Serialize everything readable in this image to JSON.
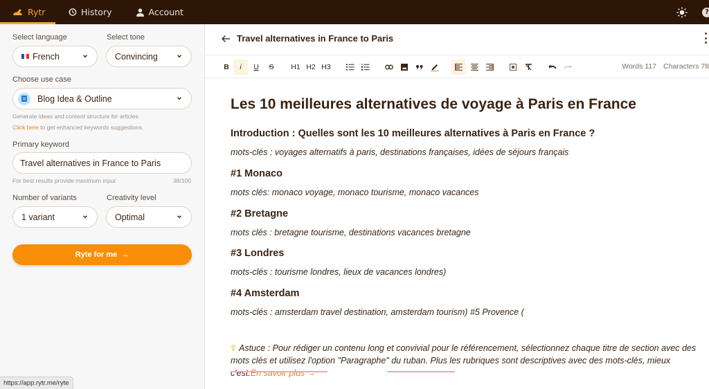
{
  "topnav": {
    "brand": "Rytr",
    "items": [
      {
        "label": "History",
        "icon": "history-icon"
      },
      {
        "label": "Account",
        "icon": "user-icon"
      }
    ],
    "right_icons": [
      "sun-icon",
      "help-icon"
    ],
    "help_glyph": "?"
  },
  "sidebar": {
    "language": {
      "label": "Select language",
      "value": "French"
    },
    "tone": {
      "label": "Select tone",
      "value": "Convincing"
    },
    "use_case": {
      "label": "Choose use case",
      "value": "Blog Idea & Outline",
      "description": "Generate ideas and content structure for articles",
      "link_text": "Click here",
      "link_suffix": " to get enhanced keywords suggestions."
    },
    "keyword": {
      "label": "Primary keyword",
      "value": "Travel alternatives in France to Paris",
      "hint": "For best results provide maximum input",
      "counter": "38/100"
    },
    "variants": {
      "label": "Number of variants",
      "value": "1 variant"
    },
    "creativity": {
      "label": "Creativity level",
      "value": "Optimal"
    },
    "ryte_button": "Ryte for me",
    "ryte_arrow": "→"
  },
  "status_bar": {
    "url": "https://app.rytr.me/ryte"
  },
  "document": {
    "title": "Travel alternatives in France to Paris",
    "toolbar": {
      "bold": "B",
      "italic": "i",
      "underline": "U",
      "strike": "S",
      "h1": "H1",
      "h2": "H2",
      "h3": "H3",
      "active": [
        "italic",
        "align-left"
      ]
    },
    "stats": {
      "words": "Words 117",
      "characters": "Characters 78"
    },
    "content": {
      "h1": "Les 10 meilleures alternatives de voyage à Paris en France",
      "intro_heading": "Introduction : Quelles sont les 10 meilleures alternatives à Paris en France ?",
      "intro_keywords": "mots-clés : voyages alternatifs à paris, destinations françaises, idées de séjours français",
      "sections": [
        {
          "heading": "#1 Monaco",
          "keywords": "mots clés: monaco voyage, monaco tourisme, monaco vacances"
        },
        {
          "heading": "#2 Bretagne",
          "keywords": "mots clés : bretagne tourisme, destinations vacances bretagne"
        },
        {
          "heading": "#3 Londres",
          "keywords": "mots-clés : tourisme londres, lieux de vacances londres)"
        },
        {
          "heading": "#4 Amsterdam",
          "keywords": "mots-clés : amsterdam travel destination, amsterdam tourism) #5 Provence ("
        }
      ],
      "tip": "Astuce : Pour rédiger un contenu long et convivial pour le référencement, sélectionnez chaque titre de section avec des mots clés et utilisez l'option \"Paragraphe\" du ruban. Plus les rubriques sont descriptives avec des mots-clés, mieux c'est.",
      "tip_link": "En savoir plus →"
    }
  },
  "colors": {
    "nav_bg": "#2d1605",
    "brand": "#f0a830",
    "accent_orange": "#f98e08",
    "link_orange": "#f07c1e",
    "text_brown": "#3a2414",
    "active_tool_bg": "#fdf3df"
  }
}
